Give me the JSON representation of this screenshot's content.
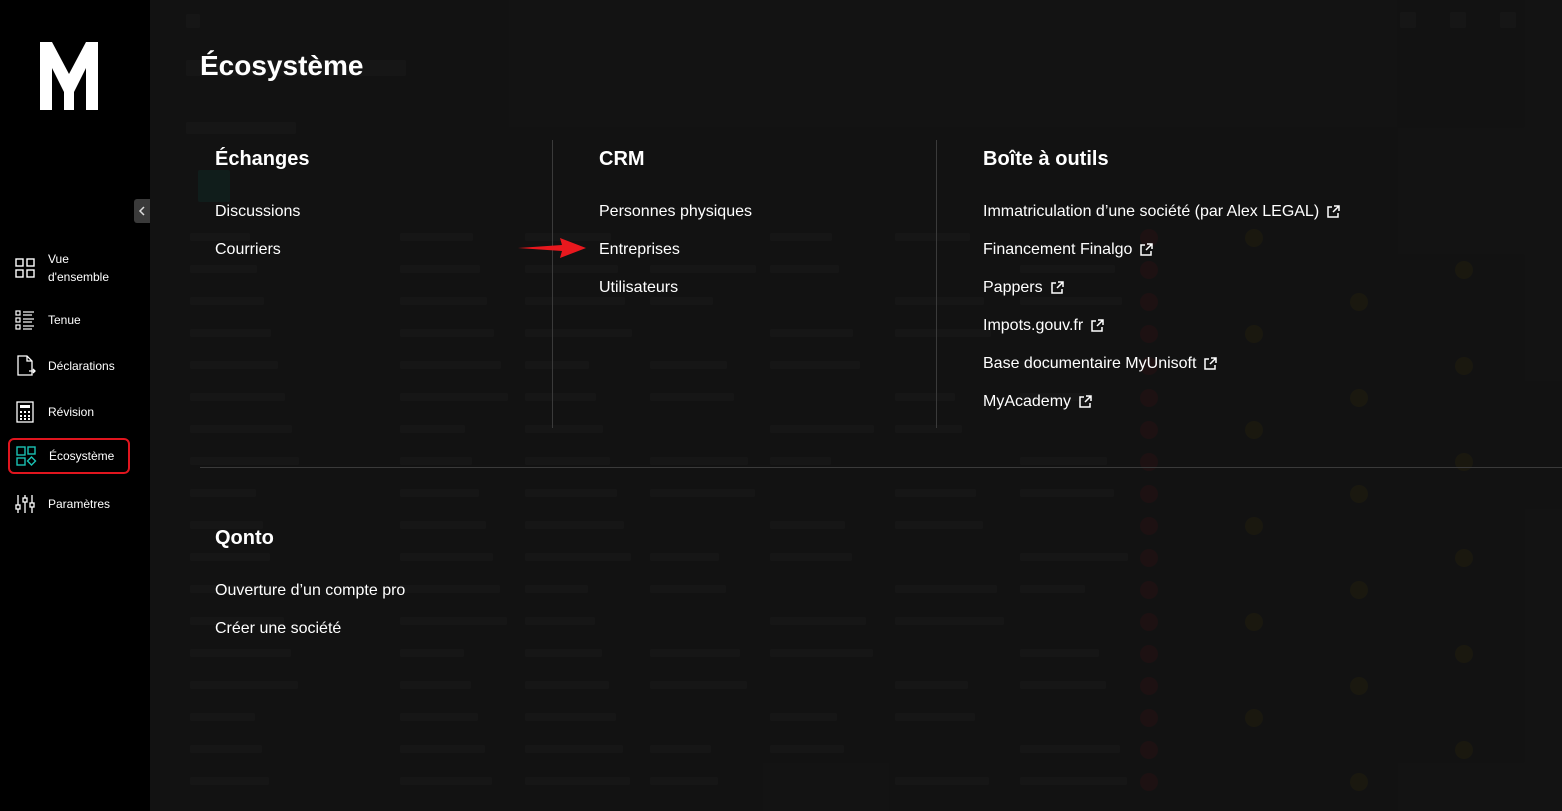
{
  "sidebar": {
    "items": [
      {
        "label": "Vue d'ensemble",
        "icon": "grid-icon"
      },
      {
        "label": "Tenue",
        "icon": "list-icon"
      },
      {
        "label": "Déclarations",
        "icon": "document-arrow-icon"
      },
      {
        "label": "Révision",
        "icon": "calculator-icon"
      },
      {
        "label": "Écosystème",
        "icon": "ecosystem-icon",
        "active": true
      },
      {
        "label": "Paramètres",
        "icon": "sliders-icon"
      }
    ]
  },
  "menu": {
    "title": "Écosystème",
    "echanges": {
      "title": "Échanges",
      "links": [
        "Discussions",
        "Courriers"
      ]
    },
    "crm": {
      "title": "CRM",
      "links": [
        "Personnes physiques",
        "Entreprises",
        "Utilisateurs"
      ]
    },
    "tools": {
      "title": "Boîte à outils",
      "links": [
        "Immatriculation d’une société (par Alex LEGAL)",
        "Financement Finalgo",
        "Pappers",
        "Impots.gouv.fr",
        "Base documentaire MyUnisoft",
        "MyAcademy"
      ]
    },
    "qonto": {
      "title": "Qonto",
      "links": [
        "Ouverture d’un compte pro",
        "Créer une société"
      ]
    }
  },
  "colors": {
    "accent": "#e0151e",
    "active_icon": "#19c2b4",
    "background": "#121212"
  }
}
